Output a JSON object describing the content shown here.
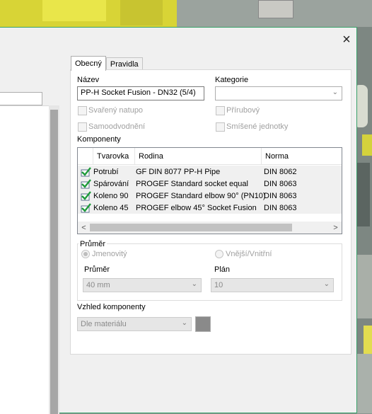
{
  "dialog": {
    "close_glyph": "×"
  },
  "tabs": [
    {
      "label": "Obecný",
      "active": true
    },
    {
      "label": "Pravidla",
      "active": false
    }
  ],
  "general": {
    "name_label": "Název",
    "name_value": "PP-H Socket Fusion - DN32 (5/4)",
    "category_label": "Kategorie",
    "category_value": "",
    "chk_welded": "Svařený natupo",
    "chk_flanged": "Přírubový",
    "chk_selfdrain": "Samoodvodnění",
    "chk_mixed_units": "Smíšené jednotky",
    "components_label": "Komponenty"
  },
  "components_table": {
    "columns": [
      "Tvarovka",
      "Rodina",
      "Norma"
    ],
    "rows": [
      {
        "fitting": "Potrubí",
        "family": "GF DIN 8077 PP-H Pipe",
        "standard": "DIN 8062"
      },
      {
        "fitting": "Spárování",
        "family": "PROGEF Standard socket equal",
        "standard": "DIN 8063"
      },
      {
        "fitting": "Koleno 90",
        "family": "PROGEF Standard elbow 90° (PN10)",
        "standard": "DIN 8063"
      },
      {
        "fitting": "Koleno 45",
        "family": "PROGEF elbow 45° Socket Fusion",
        "standard": "DIN 8063"
      }
    ],
    "check_icon": "green-check-icon",
    "scroll_left": "<",
    "scroll_right": ">"
  },
  "diameter": {
    "group_title": "Průměr",
    "radio_nominal": "Jmenovitý",
    "radio_outer_inner": "Vnější/Vnitřní",
    "diameter_label": "Průměr",
    "diameter_value": "40 mm",
    "schedule_label": "Plán",
    "schedule_value": "10"
  },
  "appearance": {
    "label": "Vzhled komponenty",
    "value": "Dle materiálu",
    "swatch_color": "#8a8a8a"
  }
}
